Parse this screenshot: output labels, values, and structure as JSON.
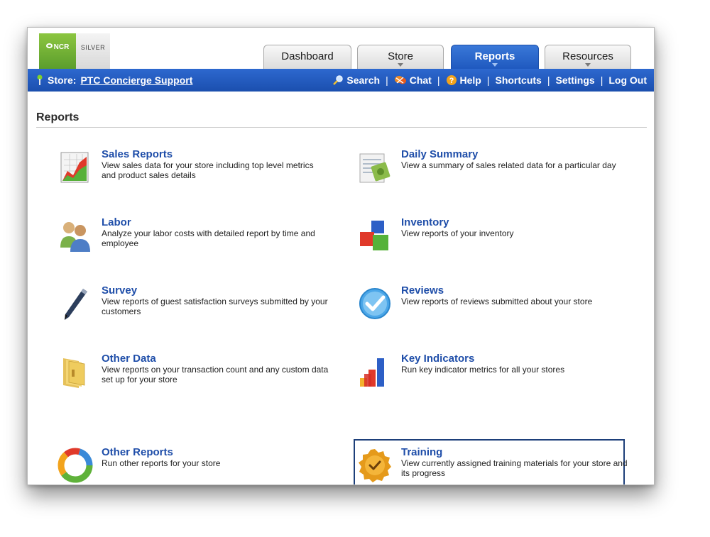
{
  "logo": {
    "brand": "NCR",
    "tier": "SILVER"
  },
  "tabs": [
    {
      "label": "Dashboard",
      "active": false
    },
    {
      "label": "Store",
      "active": false
    },
    {
      "label": "Reports",
      "active": true
    },
    {
      "label": "Resources",
      "active": false
    }
  ],
  "navbar": {
    "store_label": "Store:",
    "store_name": "PTC Concierge Support",
    "links": {
      "search": "Search",
      "chat": "Chat",
      "help": "Help",
      "shortcuts": "Shortcuts",
      "settings": "Settings",
      "logout": "Log Out"
    },
    "separator": "|"
  },
  "page": {
    "title": "Reports"
  },
  "reports": [
    {
      "title": "Sales Reports",
      "desc": "View sales data for your store including top level metrics and product sales details",
      "icon": "sales-chart-icon"
    },
    {
      "title": "Daily Summary",
      "desc": "View a summary of sales related data for a particular day",
      "icon": "daily-summary-icon"
    },
    {
      "title": "Labor",
      "desc": "Analyze your labor costs with detailed report by time and employee",
      "icon": "people-icon"
    },
    {
      "title": "Inventory",
      "desc": "View reports of your inventory",
      "icon": "blocks-icon"
    },
    {
      "title": "Survey",
      "desc": "View reports of guest satisfaction surveys submitted by your customers",
      "icon": "pen-icon"
    },
    {
      "title": "Reviews",
      "desc": "View reports of reviews submitted about your store",
      "icon": "checkmark-icon"
    },
    {
      "title": "Other Data",
      "desc": "View reports on your transaction count and any custom data set up for your store",
      "icon": "folder-icon"
    },
    {
      "title": "Key Indicators",
      "desc": "Run key indicator metrics for all your stores",
      "icon": "bar-chart-icon"
    },
    {
      "title": "Other Reports",
      "desc": "Run other reports for your store",
      "icon": "pie-chart-icon"
    },
    {
      "title": "Training",
      "desc": "View currently assigned training materials for your store and its progress",
      "icon": "badge-icon",
      "selected": true
    }
  ],
  "colors": {
    "accent": "#1f59bf",
    "link": "#1f4ea9",
    "brand_green": "#6fb23a"
  }
}
